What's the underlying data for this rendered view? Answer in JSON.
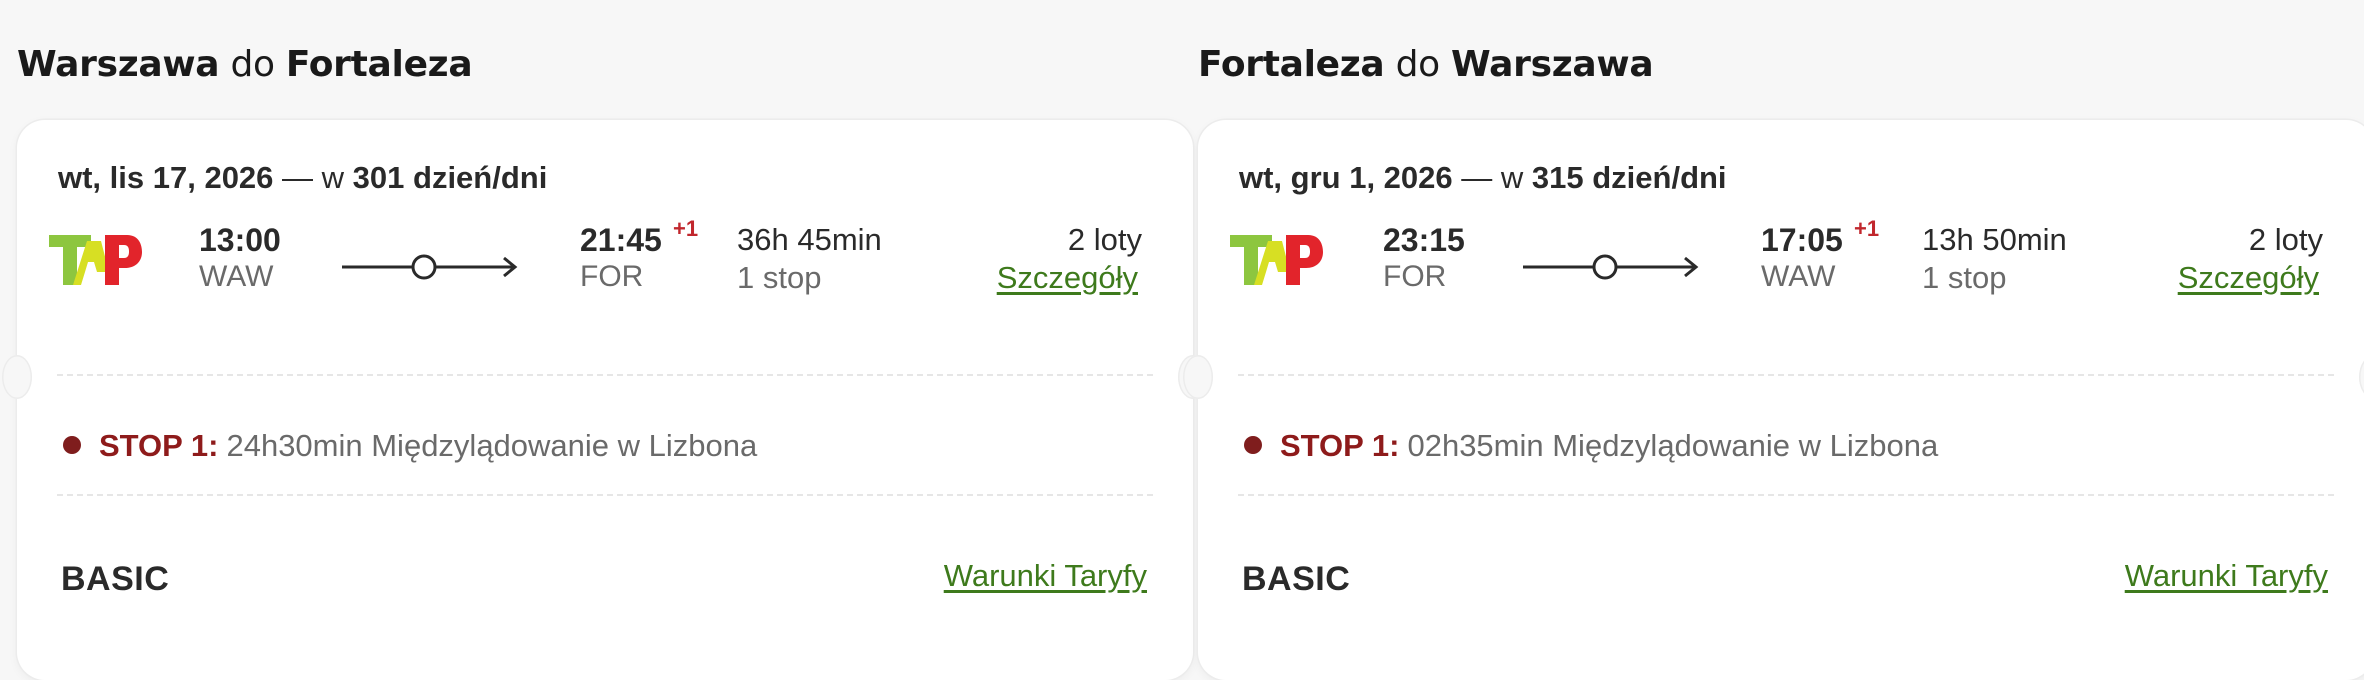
{
  "outbound": {
    "heading": {
      "from": "Warszawa",
      "connector": "do",
      "to": "Fortaleza"
    },
    "date": "wt, lis 17, 2026",
    "in_text": "— w",
    "days": "301 dzień/dni",
    "airline_logo": "TAP",
    "departure_time": "13:00",
    "departure_airport": "WAW",
    "arrival_time": "21:45",
    "arrival_day_offset": "+1",
    "arrival_airport": "FOR",
    "duration": "36h 45min",
    "stops": "1 stop",
    "flights": "2 loty",
    "details_label": "Szczegóły",
    "stop_label": "STOP 1:",
    "stop_text": "24h30min Międzylądowanie w Lizbona",
    "fare": "BASIC",
    "conditions_label": "Warunki Taryfy"
  },
  "inbound": {
    "heading": {
      "from": "Fortaleza",
      "connector": "do",
      "to": "Warszawa"
    },
    "date": "wt, gru 1, 2026",
    "in_text": "— w",
    "days": "315 dzień/dni",
    "airline_logo": "TAP",
    "departure_time": "23:15",
    "departure_airport": "FOR",
    "arrival_time": "17:05",
    "arrival_day_offset": "+1",
    "arrival_airport": "WAW",
    "duration": "13h 50min",
    "stops": "1 stop",
    "flights": "2 loty",
    "details_label": "Szczegóły",
    "stop_label": "STOP 1:",
    "stop_text": "02h35min Międzylądowanie w Lizbona",
    "fare": "BASIC",
    "conditions_label": "Warunki Taryfy"
  },
  "colors": {
    "link": "#3e7a1c",
    "stop": "#8e1b1b",
    "day_offset": "#c1272d",
    "logo_green": "#8dc63f",
    "logo_yellow": "#d7df23",
    "logo_red": "#e2242b"
  }
}
